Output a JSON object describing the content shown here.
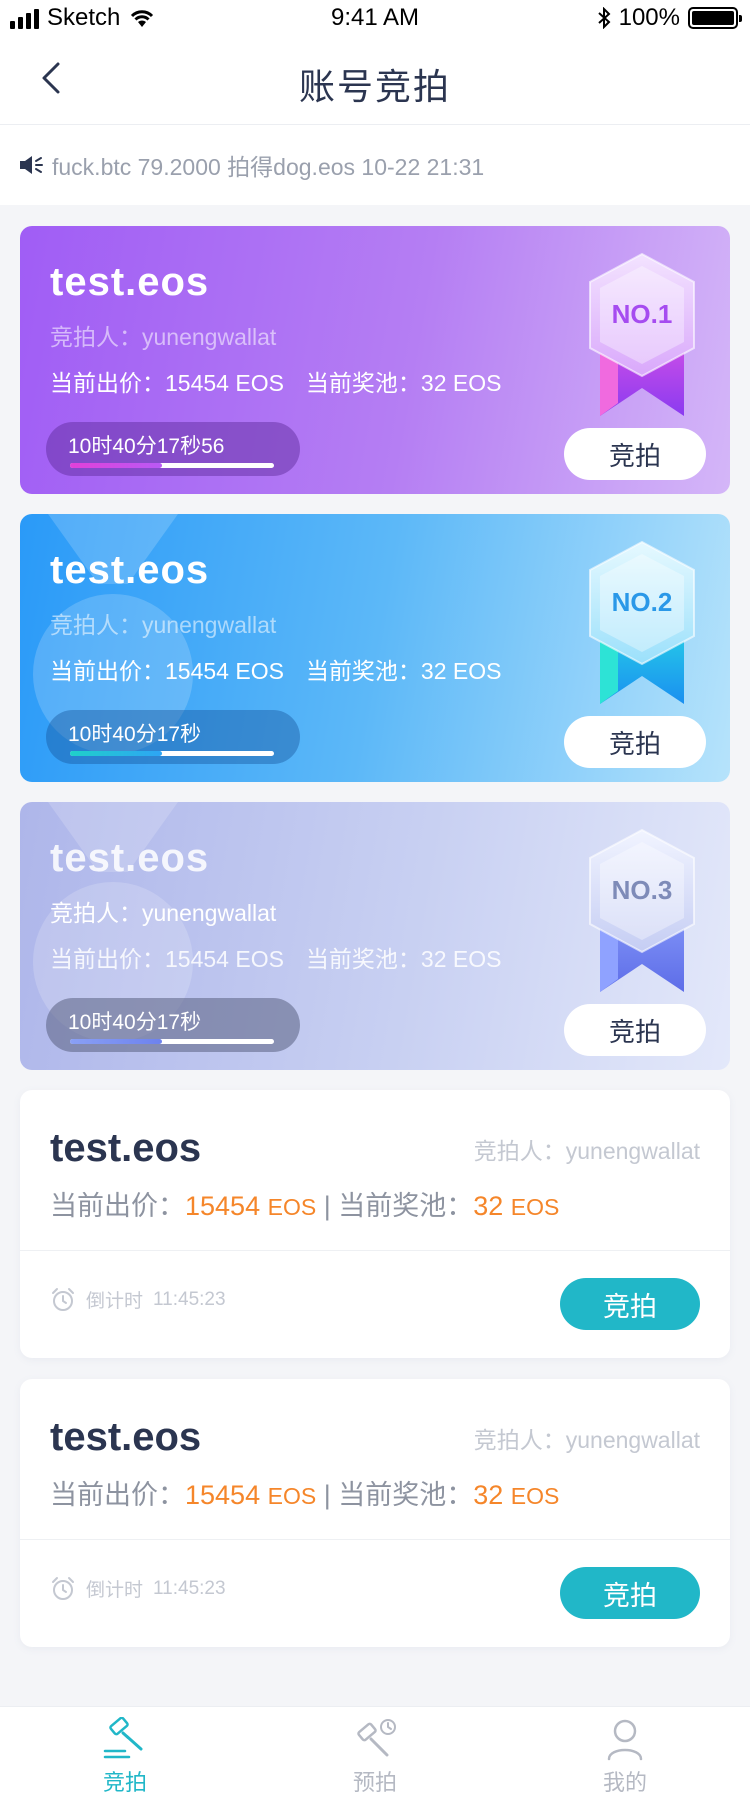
{
  "status": {
    "carrier": "Sketch",
    "time": "9:41 AM",
    "battery": "100%"
  },
  "nav": {
    "title": "账号竞拍"
  },
  "notice": {
    "text": "fuck.btc 79.2000 拍得dog.eos 10-22 21:31"
  },
  "top_cards": [
    {
      "name": "test.eos",
      "bidder": "竞拍人：yunengwallat",
      "price": "当前出价：15454 EOS",
      "pool": "当前奖池：32 EOS",
      "timer": "10时40分17秒56",
      "rank": "NO.1",
      "button": "竞拍",
      "progress": 0.45
    },
    {
      "name": "test.eos",
      "bidder": "竞拍人：yunengwallat",
      "price": "当前出价：15454 EOS",
      "pool": "当前奖池：32 EOS",
      "timer": "10时40分17秒",
      "rank": "NO.2",
      "button": "竞拍",
      "progress": 0.45
    },
    {
      "name": "test.eos",
      "bidder": "竞拍人：yunengwallat",
      "price": "当前出价：15454 EOS",
      "pool": "当前奖池：32 EOS",
      "timer": "10时40分17秒",
      "rank": "NO.3",
      "button": "竞拍",
      "progress": 0.45
    }
  ],
  "list_cards": [
    {
      "name": "test.eos",
      "bidder": "竞拍人：yunengwallat",
      "price_label": "当前出价：",
      "price_value": "15454",
      "price_unit": "EOS",
      "separator": "|",
      "pool_label": "当前奖池：",
      "pool_value": "32",
      "pool_unit": "EOS",
      "countdown_label": "倒计时",
      "countdown": "11:45:23",
      "button": "竞拍"
    },
    {
      "name": "test.eos",
      "bidder": "竞拍人：yunengwallat",
      "price_label": "当前出价：",
      "price_value": "15454",
      "price_unit": "EOS",
      "separator": "|",
      "pool_label": "当前奖池：",
      "pool_value": "32",
      "pool_unit": "EOS",
      "countdown_label": "倒计时",
      "countdown": "11:45:23",
      "button": "竞拍"
    }
  ],
  "tabs": [
    {
      "label": "竞拍",
      "icon": "gavel-icon",
      "active": true
    },
    {
      "label": "预拍",
      "icon": "gavel-clock-icon",
      "active": false
    },
    {
      "label": "我的",
      "icon": "user-icon",
      "active": false
    }
  ],
  "colors": {
    "accent": "#21b7c8",
    "price": "#f5862a",
    "title": "#2b3550"
  }
}
